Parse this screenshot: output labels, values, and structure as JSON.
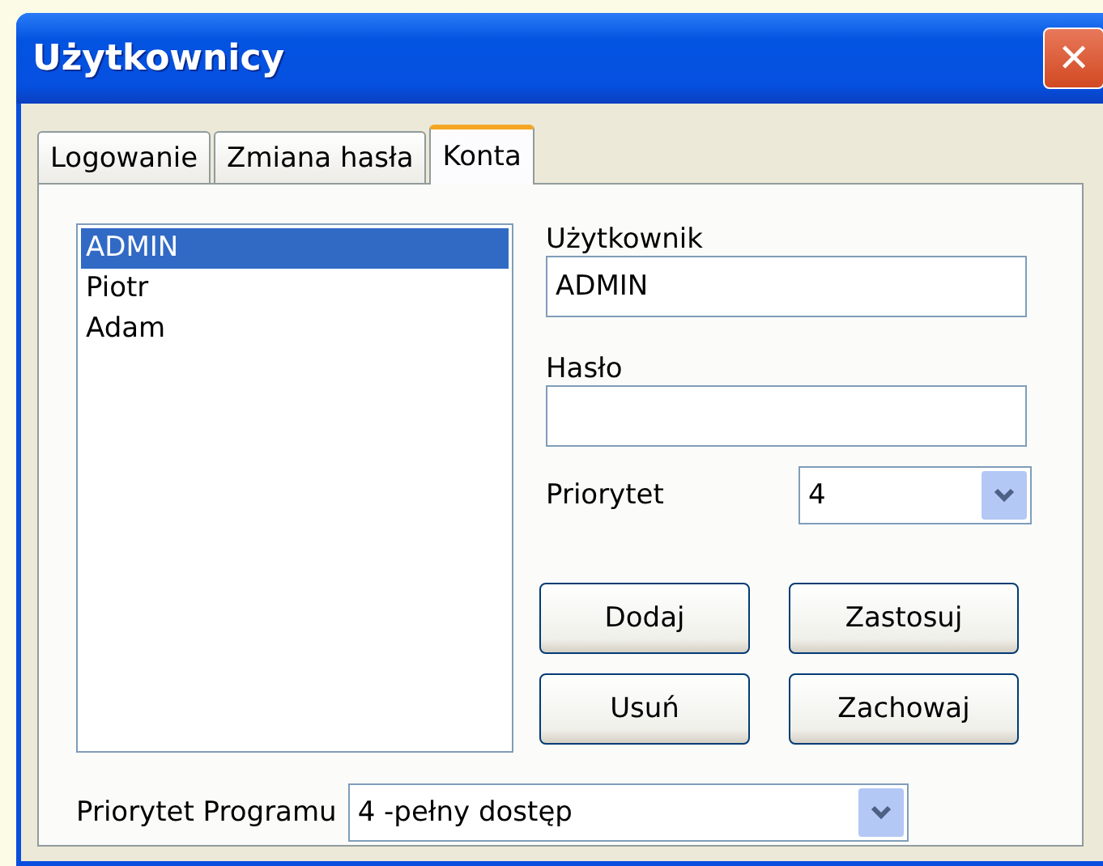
{
  "window": {
    "title": "Użytkownicy",
    "close": "✕"
  },
  "tabs": [
    {
      "label": "Logowanie",
      "selected": false
    },
    {
      "label": "Zmiana hasła",
      "selected": false
    },
    {
      "label": "Konta",
      "selected": true
    }
  ],
  "users": [
    {
      "name": "ADMIN",
      "selected": true
    },
    {
      "name": "Piotr",
      "selected": false
    },
    {
      "name": "Adam",
      "selected": false
    }
  ],
  "user_field": {
    "label": "Użytkownik",
    "value": "ADMIN"
  },
  "password_field": {
    "label": "Hasło"
  },
  "priority": {
    "label": "Priorytet",
    "value": "4"
  },
  "buttons": [
    "Dodaj",
    "Zastosuj",
    "Usuń",
    "Zachowaj"
  ],
  "program_priority": {
    "label": "Priorytet Programu",
    "value": "4 -pełny dostęp"
  }
}
